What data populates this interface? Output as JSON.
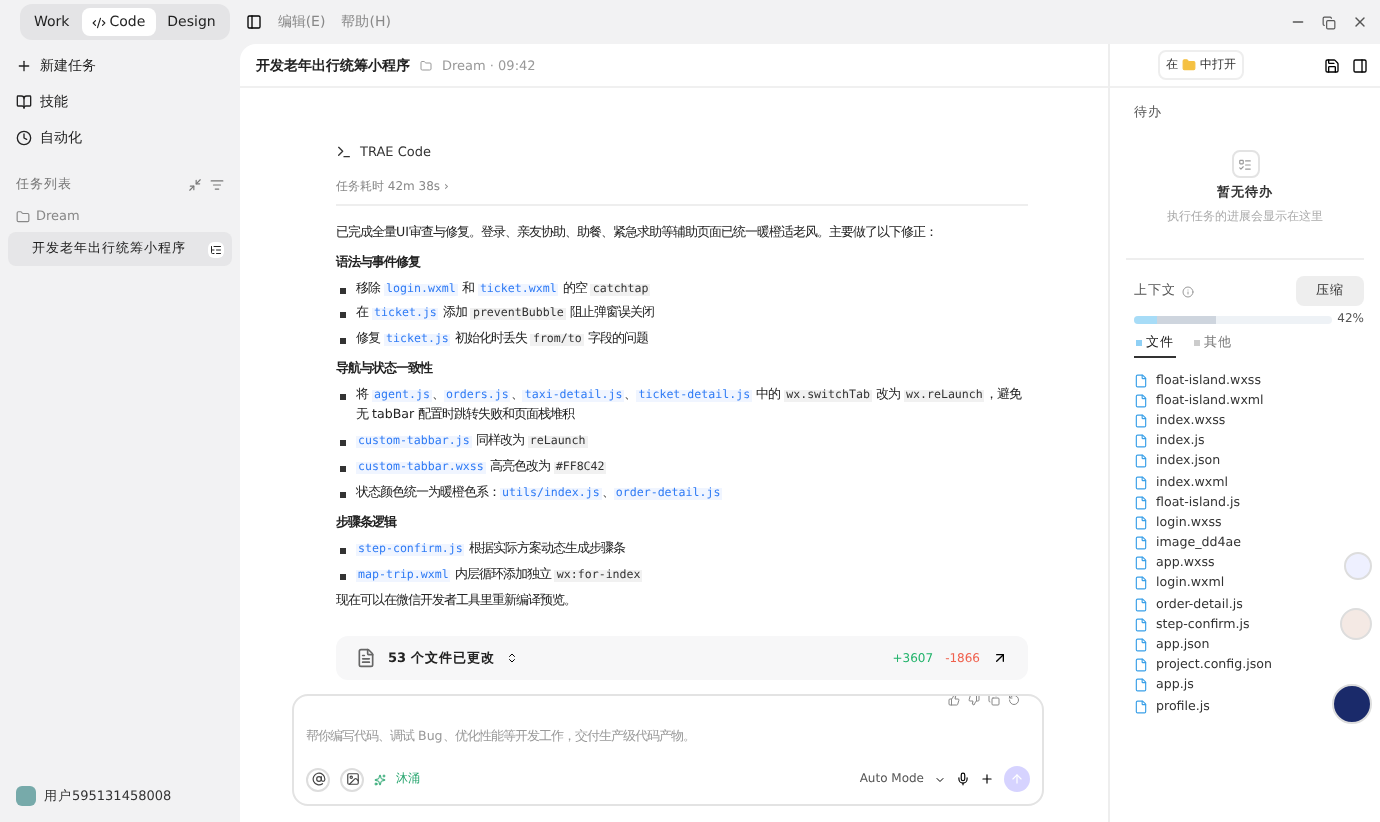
{
  "topbar": {
    "modes": [
      {
        "label": "Work",
        "selected": false
      },
      {
        "label": "Code",
        "selected": true
      },
      {
        "label": "Design",
        "selected": false
      }
    ],
    "menus": [
      "编辑(E)",
      "帮助(H)"
    ]
  },
  "sidebar": {
    "actions": [
      "新建任务",
      "技能",
      "自动化"
    ],
    "section": "任务列表",
    "folder": {
      "label": "Dream",
      "tasks": [
        {
          "label": "开发老年出行统筹小程序",
          "selected": true
        }
      ]
    },
    "user": "用户595131458008"
  },
  "chat": {
    "title": "开发老年出行统筹小程序",
    "meta": "Dream · 09:42",
    "agent": "TRAE Code",
    "duration": "任务耗时 42m 38s ›",
    "blocks": [
      {
        "kind": "para",
        "parts": [
          {
            "kind": "text",
            "text": "已完成全量UI审查与修复。登录、亲友协助、助餐、紧急求助等辅助页面已统一暖橙适老风。主要做了以下修正："
          }
        ]
      },
      {
        "kind": "heading",
        "parts": [
          {
            "kind": "text",
            "text": "语法与事件修复"
          }
        ]
      },
      {
        "kind": "bullet",
        "parts": [
          {
            "kind": "text",
            "text": "移除 "
          },
          {
            "kind": "file",
            "text": "login.wxml"
          },
          {
            "kind": "text",
            "text": " 和 "
          },
          {
            "kind": "file",
            "text": "ticket.wxml"
          },
          {
            "kind": "text",
            "text": " 的空 "
          },
          {
            "kind": "code",
            "text": "catchtap"
          }
        ]
      },
      {
        "kind": "bullet",
        "parts": [
          {
            "kind": "text",
            "text": "在 "
          },
          {
            "kind": "file",
            "text": "ticket.js"
          },
          {
            "kind": "text",
            "text": " 添加 "
          },
          {
            "kind": "code",
            "text": "preventBubble"
          },
          {
            "kind": "text",
            "text": " 阻止弹窗误关闭"
          }
        ]
      },
      {
        "kind": "bullet",
        "parts": [
          {
            "kind": "text",
            "text": "修复 "
          },
          {
            "kind": "file",
            "text": "ticket.js"
          },
          {
            "kind": "text",
            "text": " 初始化时丢失 "
          },
          {
            "kind": "code",
            "text": "from/to"
          },
          {
            "kind": "text",
            "text": " 字段的问题"
          }
        ]
      },
      {
        "kind": "heading",
        "parts": [
          {
            "kind": "text",
            "text": "导航与状态一致性"
          }
        ]
      },
      {
        "kind": "bullet",
        "parts": [
          {
            "kind": "text",
            "text": "将 "
          },
          {
            "kind": "file",
            "text": "agent.js"
          },
          {
            "kind": "text",
            "text": "、"
          },
          {
            "kind": "file",
            "text": "orders.js"
          },
          {
            "kind": "text",
            "text": "、"
          },
          {
            "kind": "file",
            "text": "taxi-detail.js"
          },
          {
            "kind": "text",
            "text": "、"
          },
          {
            "kind": "file",
            "text": "ticket-detail.js"
          },
          {
            "kind": "text",
            "text": " 中的 "
          },
          {
            "kind": "code",
            "text": "wx.switchTab"
          },
          {
            "kind": "text",
            "text": " 改为 "
          },
          {
            "kind": "code",
            "text": "wx.reLaunch"
          },
          {
            "kind": "text",
            "text": "，避免无 tabBar 配置时跳转失败和页面栈堆积"
          }
        ]
      },
      {
        "kind": "bullet",
        "parts": [
          {
            "kind": "file",
            "text": "custom-tabbar.js"
          },
          {
            "kind": "text",
            "text": " 同样改为 "
          },
          {
            "kind": "code",
            "text": "reLaunch"
          }
        ]
      },
      {
        "kind": "bullet",
        "parts": [
          {
            "kind": "file",
            "text": "custom-tabbar.wxss"
          },
          {
            "kind": "text",
            "text": " 高亮色改为 "
          },
          {
            "kind": "code",
            "text": "#FF8C42"
          }
        ]
      },
      {
        "kind": "bullet",
        "parts": [
          {
            "kind": "text",
            "text": "状态颜色统一为暖橙色系："
          },
          {
            "kind": "file",
            "text": "utils/index.js"
          },
          {
            "kind": "text",
            "text": "、"
          },
          {
            "kind": "file",
            "text": "order-detail.js"
          }
        ]
      },
      {
        "kind": "heading",
        "parts": [
          {
            "kind": "text",
            "text": "步骤条逻辑"
          }
        ]
      },
      {
        "kind": "bullet",
        "parts": [
          {
            "kind": "file",
            "text": "step-confirm.js"
          },
          {
            "kind": "text",
            "text": " 根据实际方案动态生成步骤条"
          }
        ]
      },
      {
        "kind": "bullet",
        "parts": [
          {
            "kind": "file",
            "text": "map-trip.wxml"
          },
          {
            "kind": "text",
            "text": " 内层循环添加独立 "
          },
          {
            "kind": "code",
            "text": "wx:for-index"
          }
        ]
      },
      {
        "kind": "para",
        "parts": [
          {
            "kind": "text",
            "text": "现在可以在微信开发者工具里重新编译预览。"
          }
        ]
      }
    ],
    "changes": {
      "label": "53 个文件已更改",
      "added": "+3607",
      "removed": "-1866"
    },
    "composer": {
      "placeholder": "帮你编写代码、调试 Bug、优化性能等开发工作，交付生产级代码产物。",
      "chip": "沐涌",
      "mode": "Auto Mode"
    }
  },
  "panel": {
    "open_prefix": "在",
    "open_suffix": "中打开",
    "todo_title": "待办",
    "todo_empty": "暂无待办",
    "todo_hint": "执行任务的进展会显示在这里",
    "context_title": "上下文",
    "compress": "压缩",
    "context": {
      "level": 0.42,
      "reading": "42%"
    },
    "tabs": [
      {
        "label": "文件",
        "selected": true
      },
      {
        "label": "其他",
        "selected": false
      }
    ],
    "files": [
      "float-island.wxss",
      "float-island.wxml",
      "index.wxss",
      "index.js",
      "index.json",
      "index.wxml",
      "float-island.js",
      "login.wxss",
      "image_dd4ae",
      "app.wxss",
      "login.wxml",
      "order-detail.js",
      "step-confirm.js",
      "app.json",
      "project.config.json",
      "app.js",
      "profile.js"
    ]
  }
}
